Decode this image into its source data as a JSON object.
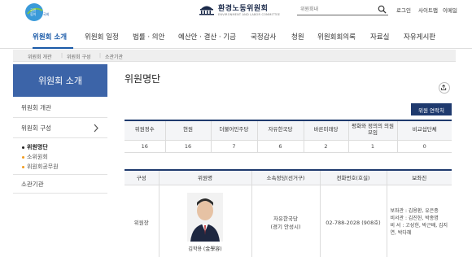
{
  "header": {
    "left_logo_text": "국민에게 힘이 되는 국회",
    "brand_title": "환경노동위원회",
    "brand_sub": "ENVIRONMENT AND LABOR COMMITTEE",
    "search_placeholder": "위원회내",
    "util_links": [
      "로그인",
      "사이트맵",
      "이메일"
    ]
  },
  "gnb": {
    "items": [
      "위원회 소개",
      "위원회 일정",
      "법률 · 의안",
      "예산안 · 결산 · 기금",
      "국정감사",
      "청원",
      "위원회회의록",
      "자료실",
      "자유게시판"
    ],
    "active": "위원회 소개"
  },
  "breadcrumb": [
    "위원회 개관",
    "위원회 구성",
    "소관기관"
  ],
  "sidebar": {
    "title": "위원회 소개",
    "items": [
      "위원회 개관",
      "위원회 구성",
      "소관기관"
    ],
    "subitems": [
      "위원명단",
      "소위원회",
      "위원회공무원"
    ],
    "active_sub": "위원명단"
  },
  "main": {
    "page_title": "위원명단",
    "contact_button": "위원 연락처",
    "summary_table": {
      "headers": [
        "위원정수",
        "현원",
        "더불어민주당",
        "자유한국당",
        "바른미래당",
        "평화와 정의의 의원 모임",
        "비교섭단체"
      ],
      "values": [
        "16",
        "16",
        "7",
        "6",
        "2",
        "1",
        "0"
      ]
    },
    "members_table": {
      "headers": [
        "구성",
        "위원명",
        "소속정당(선거구)",
        "전화번호(호실)",
        "보좌진"
      ],
      "rows": [
        {
          "role": "위원장",
          "name": "김학용 (金學容)",
          "party": "자유한국당",
          "district": "(경기 안성시)",
          "phone": "02-788-2028 (908호)",
          "staff_aide": "보좌관 : 김용환, 유은종",
          "staff_secretary": "비서관 : 김진헌, 박종명",
          "staff_sec2": "비   서 : 고성헌, 박근배, 김지연, 박다혜"
        }
      ]
    }
  }
}
